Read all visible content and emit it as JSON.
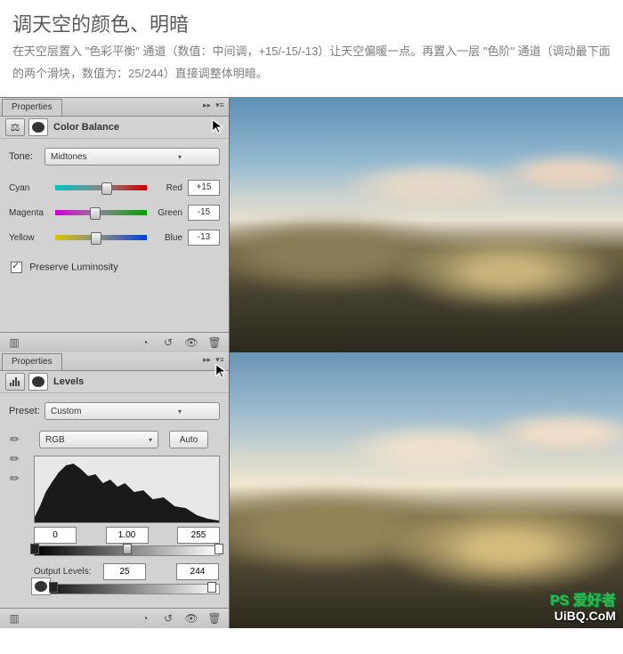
{
  "article": {
    "title": "调天空的颜色、明暗",
    "body": "在天空层置入 \"色彩平衡\" 通道（数值：中间调，+15/-15/-13）让天空偏暖一点。再置入一层 \"色阶\" 通道（调动最下面的两个滑块，数值为：25/244）直接调整体明暗。"
  },
  "propertiesTab": "Properties",
  "colorBalance": {
    "title": "Color Balance",
    "toneLabel": "Tone:",
    "toneValue": "Midtones",
    "sliders": [
      {
        "left": "Cyan",
        "right": "Red",
        "value": "+15",
        "pos": 56
      },
      {
        "left": "Magenta",
        "right": "Green",
        "value": "-15",
        "pos": 44
      },
      {
        "left": "Yellow",
        "right": "Blue",
        "value": "-13",
        "pos": 45
      }
    ],
    "preserve": "Preserve Luminosity"
  },
  "levels": {
    "title": "Levels",
    "presetLabel": "Preset:",
    "presetValue": "Custom",
    "channel": "RGB",
    "auto": "Auto",
    "inputs": {
      "black": "0",
      "gamma": "1.00",
      "white": "255"
    },
    "outputLabel": "Output Levels:",
    "outputs": {
      "black": "25",
      "white": "244"
    }
  },
  "watermark": {
    "line1": "PS 爱好者",
    "line2": "UiBQ.CoM"
  }
}
